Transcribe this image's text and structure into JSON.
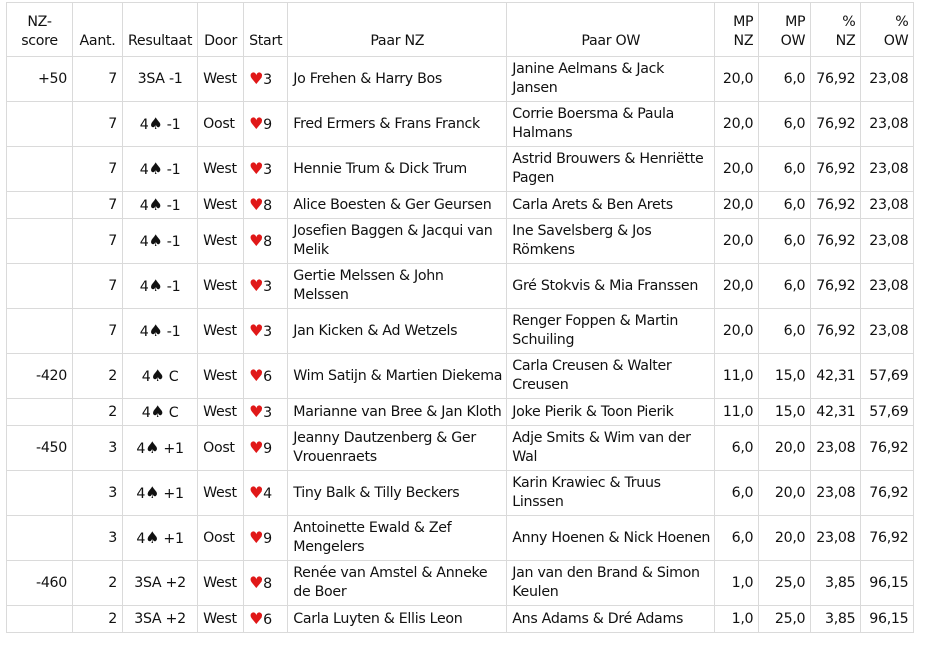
{
  "table": {
    "headers": {
      "nzscore": [
        "NZ-",
        "score"
      ],
      "aant": "Aant.",
      "resultaat": "Resultaat",
      "door": "Door",
      "start": "Start",
      "paar_nz": "Paar NZ",
      "paar_ow": "Paar OW",
      "mp_nz": [
        "MP",
        "NZ"
      ],
      "mp_ow": [
        "MP",
        "OW"
      ],
      "pct_nz": [
        "%",
        "NZ"
      ],
      "pct_ow": [
        "%",
        "OW"
      ]
    },
    "rows": [
      {
        "nzscore": "+50",
        "aant": "7",
        "contract": "3SA",
        "suit": "",
        "result": "-1",
        "door": "West",
        "start_suit": "♥",
        "start_card": "3",
        "paar_nz": "Jo Frehen & Harry Bos",
        "paar_ow": "Janine Aelmans & Jack Jansen",
        "mp_nz": "20,0",
        "mp_ow": "6,0",
        "pct_nz": "76,92",
        "pct_ow": "23,08"
      },
      {
        "nzscore": "",
        "aant": "7",
        "contract": "4",
        "suit": "♠",
        "result": "-1",
        "door": "Oost",
        "start_suit": "♥",
        "start_card": "9",
        "paar_nz": "Fred Ermers & Frans Franck",
        "paar_ow": "Corrie Boersma & Paula Halmans",
        "mp_nz": "20,0",
        "mp_ow": "6,0",
        "pct_nz": "76,92",
        "pct_ow": "23,08"
      },
      {
        "nzscore": "",
        "aant": "7",
        "contract": "4",
        "suit": "♠",
        "result": "-1",
        "door": "West",
        "start_suit": "♥",
        "start_card": "3",
        "paar_nz": "Hennie Trum & Dick Trum",
        "paar_ow": "Astrid Brouwers & Henriëtte Pagen",
        "mp_nz": "20,0",
        "mp_ow": "6,0",
        "pct_nz": "76,92",
        "pct_ow": "23,08"
      },
      {
        "nzscore": "",
        "aant": "7",
        "contract": "4",
        "suit": "♠",
        "result": "-1",
        "door": "West",
        "start_suit": "♥",
        "start_card": "8",
        "paar_nz": "Alice Boesten & Ger Geursen",
        "paar_ow": "Carla Arets & Ben Arets",
        "mp_nz": "20,0",
        "mp_ow": "6,0",
        "pct_nz": "76,92",
        "pct_ow": "23,08"
      },
      {
        "nzscore": "",
        "aant": "7",
        "contract": "4",
        "suit": "♠",
        "result": "-1",
        "door": "West",
        "start_suit": "♥",
        "start_card": "8",
        "paar_nz": "Josefien Baggen & Jacqui van Melik",
        "paar_ow": "Ine Savelsberg & Jos Römkens",
        "mp_nz": "20,0",
        "mp_ow": "6,0",
        "pct_nz": "76,92",
        "pct_ow": "23,08"
      },
      {
        "nzscore": "",
        "aant": "7",
        "contract": "4",
        "suit": "♠",
        "result": "-1",
        "door": "West",
        "start_suit": "♥",
        "start_card": "3",
        "paar_nz": "Gertie Melssen & John Melssen",
        "paar_ow": "Gré Stokvis & Mia Franssen",
        "mp_nz": "20,0",
        "mp_ow": "6,0",
        "pct_nz": "76,92",
        "pct_ow": "23,08"
      },
      {
        "nzscore": "",
        "aant": "7",
        "contract": "4",
        "suit": "♠",
        "result": "-1",
        "door": "West",
        "start_suit": "♥",
        "start_card": "3",
        "paar_nz": "Jan Kicken & Ad Wetzels",
        "paar_ow": "Renger Foppen & Martin Schuiling",
        "mp_nz": "20,0",
        "mp_ow": "6,0",
        "pct_nz": "76,92",
        "pct_ow": "23,08"
      },
      {
        "nzscore": "-420",
        "aant": "2",
        "contract": "4",
        "suit": "♠",
        "result": "C",
        "door": "West",
        "start_suit": "♥",
        "start_card": "6",
        "paar_nz": "Wim Satijn & Martien Diekema",
        "paar_ow": "Carla Creusen & Walter Creusen",
        "mp_nz": "11,0",
        "mp_ow": "15,0",
        "pct_nz": "42,31",
        "pct_ow": "57,69"
      },
      {
        "nzscore": "",
        "aant": "2",
        "contract": "4",
        "suit": "♠",
        "result": "C",
        "door": "West",
        "start_suit": "♥",
        "start_card": "3",
        "paar_nz": "Marianne van Bree & Jan Kloth",
        "paar_ow": "Joke Pierik & Toon Pierik",
        "mp_nz": "11,0",
        "mp_ow": "15,0",
        "pct_nz": "42,31",
        "pct_ow": "57,69"
      },
      {
        "nzscore": "-450",
        "aant": "3",
        "contract": "4",
        "suit": "♠",
        "result": "+1",
        "door": "Oost",
        "start_suit": "♥",
        "start_card": "9",
        "paar_nz": "Jeanny Dautzenberg & Ger Vrouenraets",
        "paar_ow": "Adje Smits & Wim van der Wal",
        "mp_nz": "6,0",
        "mp_ow": "20,0",
        "pct_nz": "23,08",
        "pct_ow": "76,92"
      },
      {
        "nzscore": "",
        "aant": "3",
        "contract": "4",
        "suit": "♠",
        "result": "+1",
        "door": "West",
        "start_suit": "♥",
        "start_card": "4",
        "paar_nz": "Tiny Balk & Tilly Beckers",
        "paar_ow": "Karin Krawiec & Truus Linssen",
        "mp_nz": "6,0",
        "mp_ow": "20,0",
        "pct_nz": "23,08",
        "pct_ow": "76,92"
      },
      {
        "nzscore": "",
        "aant": "3",
        "contract": "4",
        "suit": "♠",
        "result": "+1",
        "door": "Oost",
        "start_suit": "♥",
        "start_card": "9",
        "paar_nz": "Antoinette Ewald & Zef Mengelers",
        "paar_ow": "Anny Hoenen & Nick Hoenen",
        "mp_nz": "6,0",
        "mp_ow": "20,0",
        "pct_nz": "23,08",
        "pct_ow": "76,92"
      },
      {
        "nzscore": "-460",
        "aant": "2",
        "contract": "3SA",
        "suit": "",
        "result": "+2",
        "door": "West",
        "start_suit": "♥",
        "start_card": "8",
        "paar_nz": "Renée van Amstel & Anneke de Boer",
        "paar_ow": "Jan van den Brand & Simon Keulen",
        "mp_nz": "1,0",
        "mp_ow": "25,0",
        "pct_nz": "3,85",
        "pct_ow": "96,15"
      },
      {
        "nzscore": "",
        "aant": "2",
        "contract": "3SA",
        "suit": "",
        "result": "+2",
        "door": "West",
        "start_suit": "♥",
        "start_card": "6",
        "paar_nz": "Carla Luyten & Ellis Leon",
        "paar_ow": "Ans Adams & Dré Adams",
        "mp_nz": "1,0",
        "mp_ow": "25,0",
        "pct_nz": "3,85",
        "pct_ow": "96,15"
      }
    ]
  }
}
